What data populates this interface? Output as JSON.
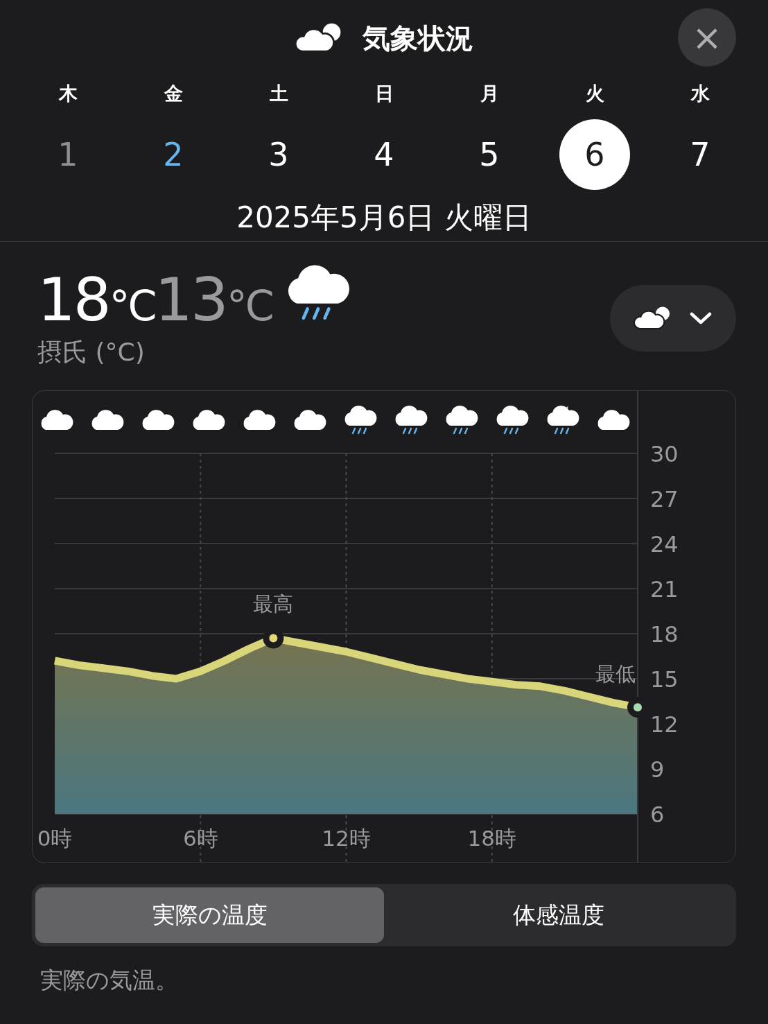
{
  "header": {
    "title": "気象状況",
    "close": "×"
  },
  "days": [
    {
      "weekday": "木",
      "date": "1",
      "past": true,
      "today": false,
      "selected": false
    },
    {
      "weekday": "金",
      "date": "2",
      "past": false,
      "today": true,
      "selected": false
    },
    {
      "weekday": "土",
      "date": "3",
      "past": false,
      "today": false,
      "selected": false
    },
    {
      "weekday": "日",
      "date": "4",
      "past": false,
      "today": false,
      "selected": false
    },
    {
      "weekday": "月",
      "date": "5",
      "past": false,
      "today": false,
      "selected": false
    },
    {
      "weekday": "火",
      "date": "6",
      "past": false,
      "today": false,
      "selected": true
    },
    {
      "weekday": "水",
      "date": "7",
      "past": false,
      "today": false,
      "selected": false
    }
  ],
  "selected_date": "2025年5月6日 火曜日",
  "summary": {
    "high": {
      "value": "18",
      "unit": "°C"
    },
    "low": {
      "value": "13",
      "unit": "°C"
    },
    "icon": {
      "kind": "rain"
    },
    "unit_label": "摂氏 (°C)"
  },
  "hourly_conditions": [
    {
      "kind": "cloud"
    },
    {
      "kind": "cloud"
    },
    {
      "kind": "cloud"
    },
    {
      "kind": "cloud"
    },
    {
      "kind": "cloud"
    },
    {
      "kind": "cloud"
    },
    {
      "kind": "rain"
    },
    {
      "kind": "rain"
    },
    {
      "kind": "rain"
    },
    {
      "kind": "rain"
    },
    {
      "kind": "night-rain"
    },
    {
      "kind": "cloud"
    }
  ],
  "chart": {
    "chart_data": {
      "type": "area",
      "x": [
        0,
        1,
        2,
        3,
        4,
        5,
        6,
        7,
        8,
        9,
        10,
        11,
        12,
        13,
        14,
        15,
        16,
        17,
        18,
        19,
        20,
        21,
        22,
        23,
        24
      ],
      "grid": true,
      "series": [
        {
          "color": "#d8d57a",
          "values": [
            16.2,
            15.9,
            15.7,
            15.5,
            15.2,
            15.0,
            15.5,
            16.2,
            17.0,
            17.7,
            17.4,
            17.1,
            16.8,
            16.4,
            16.0,
            15.6,
            15.3,
            15.0,
            14.8,
            14.6,
            14.5,
            14.2,
            13.8,
            13.4,
            13.1
          ]
        }
      ],
      "xlim": [
        0,
        24
      ],
      "ylim": [
        6,
        30
      ],
      "xticks": [
        {
          "value": 0,
          "label": "0時"
        },
        {
          "value": 6,
          "label": "6時"
        },
        {
          "value": 12,
          "label": "12時"
        },
        {
          "value": 18,
          "label": "18時"
        }
      ],
      "yticks": [
        6,
        9,
        12,
        15,
        18,
        21,
        24,
        27,
        30
      ],
      "annotations": [
        {
          "x": 9,
          "y": 17.7,
          "text": "最高"
        },
        {
          "x": 24,
          "y": 13.1,
          "text": "最低"
        }
      ]
    }
  },
  "modes": [
    {
      "label": "実際の温度",
      "selected": true
    },
    {
      "label": "体感温度",
      "selected": false
    }
  ],
  "description": "実際の気温。"
}
